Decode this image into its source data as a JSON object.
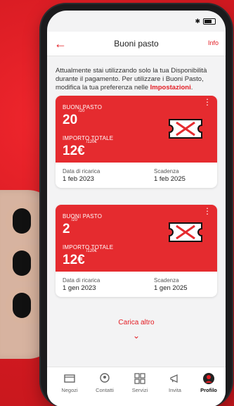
{
  "status": {
    "time": "",
    "bluetooth": "✱"
  },
  "nav": {
    "title": "Buoni pasto",
    "back_icon": "arrow-left-icon",
    "info": "Info"
  },
  "intro": {
    "text_prefix": "Attualmente stai utilizzando solo la tua Disponibilità durante il pagamento. Per utilizzare i Buoni Pasto, modifica la tua preferenza nelle ",
    "link": "Impostazioni",
    "text_suffix": "."
  },
  "cards": [
    {
      "buoni_label": "BUONI PASTO",
      "buoni_value": "20",
      "buoni_sup": "/20",
      "importo_label": "IMPORTO TOTALE",
      "importo_value": "12€",
      "importo_sup": "/120€",
      "ricarica_label": "Data di ricarica",
      "ricarica_value": "1 feb 2023",
      "scadenza_label": "Scadenza",
      "scadenza_value": "1 feb 2025"
    },
    {
      "buoni_label": "BUONI PASTO",
      "buoni_value": "2",
      "buoni_sup": "/20",
      "importo_label": "IMPORTO TOTALE",
      "importo_value": "12€",
      "importo_sup": "/120€",
      "ricarica_label": "Data di ricarica",
      "ricarica_value": "1 gen 2023",
      "scadenza_label": "Scadenza",
      "scadenza_value": "1 gen 2025"
    }
  ],
  "load_more": {
    "label": "Carica altro",
    "icon": "chevron-down-icon"
  },
  "tabs": [
    {
      "label": "Negozi",
      "icon": "store-icon"
    },
    {
      "label": "Contatti",
      "icon": "contacts-icon"
    },
    {
      "label": "Servizi",
      "icon": "grid-icon"
    },
    {
      "label": "Invita",
      "icon": "megaphone-icon"
    },
    {
      "label": "Profilo",
      "icon": "avatar-icon",
      "active": true
    }
  ],
  "colors": {
    "accent": "#e31c23",
    "card_red": "#e52b2f",
    "background": "#f3f3f4"
  }
}
